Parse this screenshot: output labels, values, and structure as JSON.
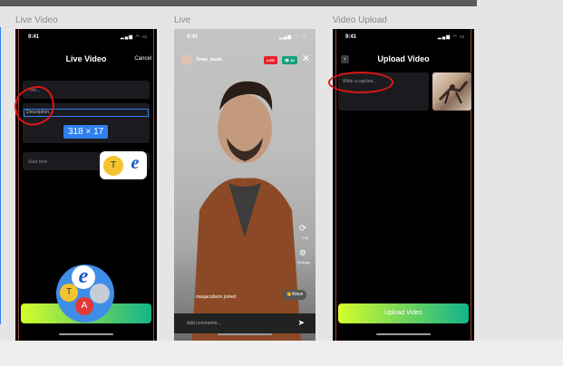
{
  "frames": [
    {
      "label": "Live Video"
    },
    {
      "label": "Live"
    },
    {
      "label": "Video Upload"
    }
  ],
  "status": {
    "time": "9:41"
  },
  "live_video": {
    "title": "Live Video",
    "cancel_label": "Cancel",
    "title_placeholder": "Title...",
    "description_placeholder": "Description...",
    "start_time_label": "Start time",
    "dimension_badge": "318 × 17"
  },
  "live": {
    "username": "Tomy_jason",
    "live_badge": "LIVE",
    "viewers": "1K",
    "flip_label": "Flip",
    "settings_label": "Settings",
    "joined_text": "masjacobson joined",
    "wave_label": "Wave",
    "comment_placeholder": "Add comments..."
  },
  "upload": {
    "title": "Upload Video",
    "caption_placeholder": "Write a caption...",
    "button_label": "Upload Video"
  },
  "avatars": {
    "t": "T",
    "a": "A",
    "e": "e"
  },
  "colors": {
    "accent_blue": "#2f80ed",
    "live_red": "#e5232e",
    "viewer_teal": "#17a07a",
    "annotation_red": "#e01616"
  }
}
